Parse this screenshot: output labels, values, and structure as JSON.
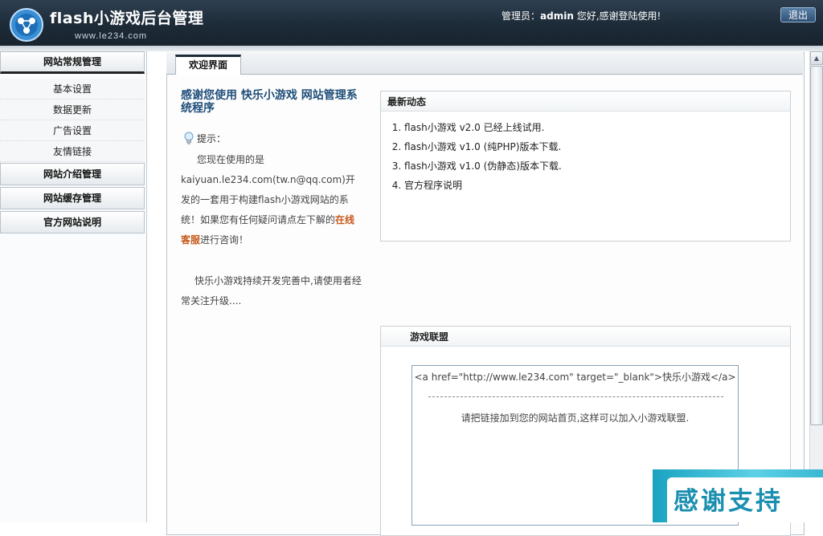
{
  "header": {
    "title": "flash小游戏后台管理",
    "url": "www.le234.com",
    "admin_label": "管理员：",
    "admin_name": "admin",
    "greeting": " 您好,感谢登陆使用!",
    "logout": "退出"
  },
  "sidebar": {
    "groups": [
      {
        "label": "网站常规管理",
        "items": [
          "基本设置",
          "数据更新",
          "广告设置",
          "友情链接"
        ]
      },
      {
        "label": "网站介绍管理"
      },
      {
        "label": "网站缓存管理"
      },
      {
        "label": "官方网站说明"
      }
    ]
  },
  "main": {
    "tab": "欢迎界面",
    "welcome_title": "感谢您使用 快乐小游戏 网站管理系统程序",
    "hint_label": "提示：",
    "intro_before": "您现在使用的是kaiyuan.le234.com(tw.n@qq.com)开发的一套用于构建flash小游戏网站的系统！如果您有任何疑问请点左下解的",
    "intro_link": "在线客服",
    "intro_after": "进行咨询！",
    "intro_2": "快乐小游戏持续开发完善中,请使用者经常关注升级....",
    "news": {
      "title": "最新动态",
      "items": [
        "flash小游戏 v2.0 已经上线试用.",
        "flash小游戏 v1.0 (纯PHP)版本下载.",
        "flash小游戏 v1.0 (伪静态)版本下载.",
        "官方程序说明"
      ]
    },
    "alliance": {
      "title": "游戏联盟",
      "code": "<a href=\"http://www.le234.com\" target=\"_blank\">快乐小游戏</a>",
      "tip": "请把链接加到您的网站首页,这样可以加入小游戏联盟."
    }
  },
  "banner": {
    "text": "感谢支持"
  }
}
